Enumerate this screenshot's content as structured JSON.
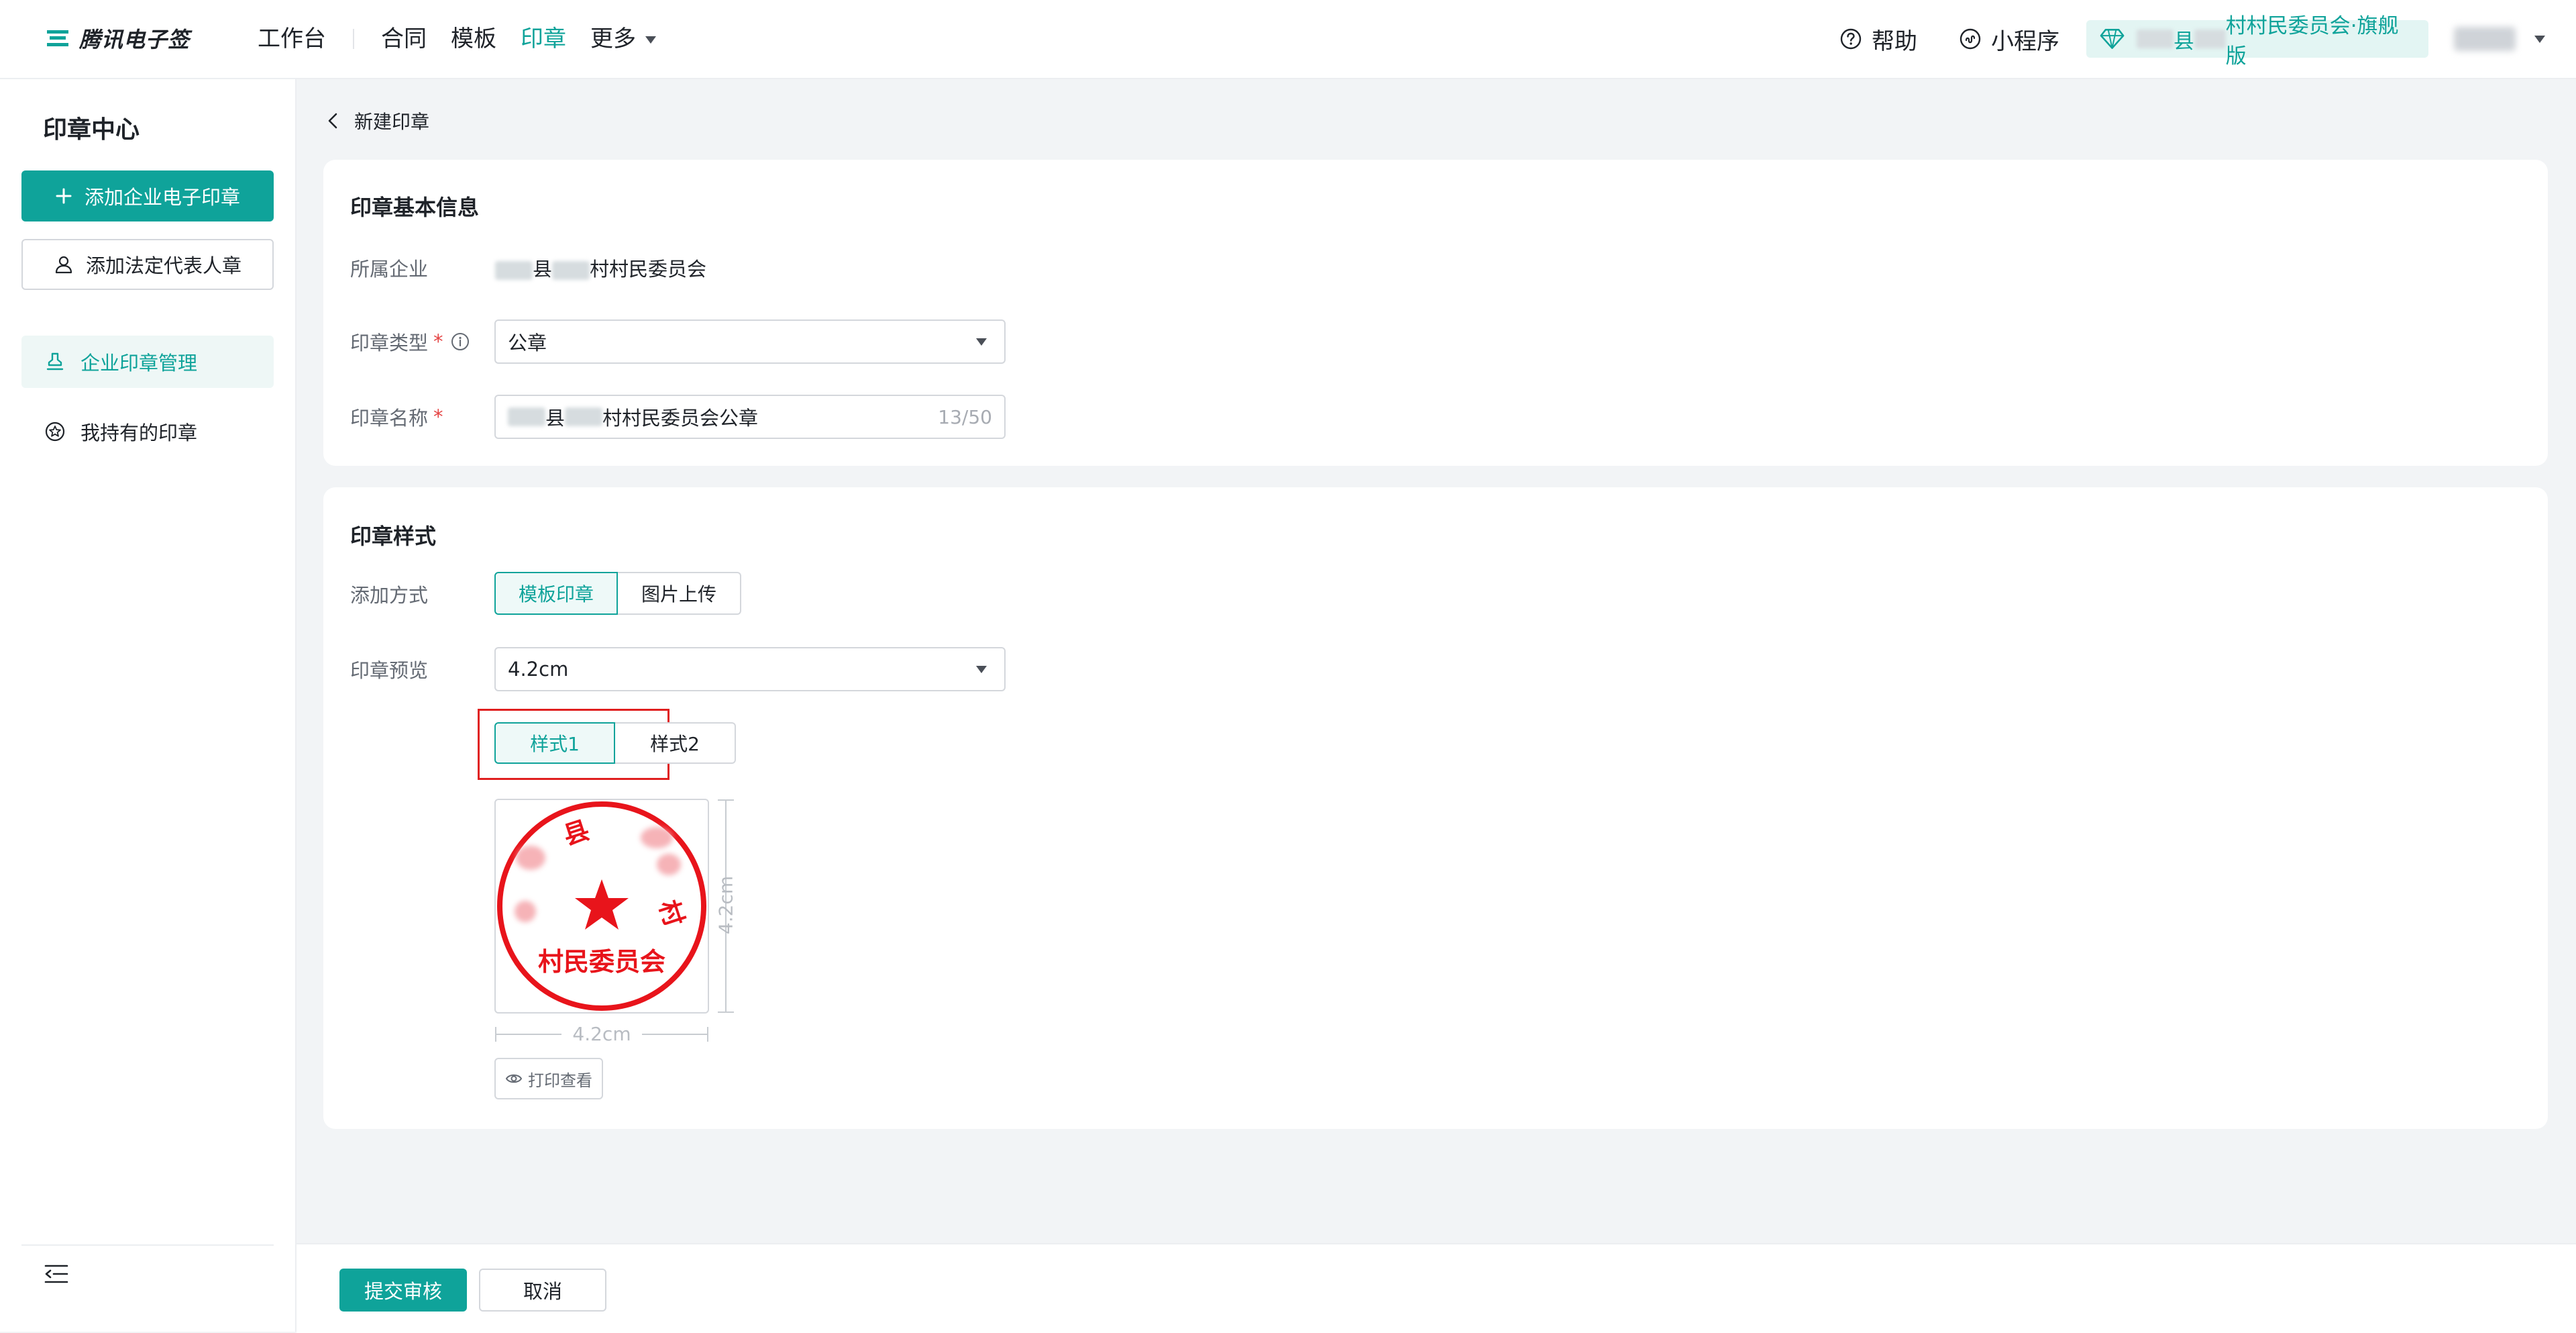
{
  "app": {
    "logo_text": "腾讯电子签",
    "brand_color": "#0fa39a"
  },
  "nav": {
    "items": [
      "工作台",
      "合同",
      "模板",
      "印章",
      "更多"
    ],
    "active": "印章"
  },
  "topright": {
    "help": "帮助",
    "miniprogram": "小程序",
    "tenant_part1": "县",
    "tenant_part2": "村村民委员会·旗舰版"
  },
  "sidebar": {
    "title": "印章中心",
    "add_company_seal": "添加企业电子印章",
    "add_legal_seal": "添加法定代表人章",
    "items": [
      {
        "label": "企业印章管理",
        "icon": "stamp-icon",
        "active": true
      },
      {
        "label": "我持有的印章",
        "icon": "badge-icon",
        "active": false
      }
    ]
  },
  "page": {
    "back_label": "新建印章"
  },
  "basic_info": {
    "title": "印章基本信息",
    "company_label": "所属企业",
    "company_part1": "县",
    "company_part2": "村村民委员会",
    "type_label": "印章类型",
    "type_value": "公章",
    "name_label": "印章名称",
    "name_part1": "县",
    "name_part2": "村村民委员会公章",
    "name_counter": "13/50"
  },
  "style_section": {
    "title": "印章样式",
    "method_label": "添加方式",
    "method_options": [
      "模板印章",
      "图片上传"
    ],
    "method_selected": "模板印章",
    "preview_label": "印章预览",
    "size_value": "4.2cm",
    "style_options": [
      "样式1",
      "样式2"
    ],
    "style_selected": "样式1",
    "seal_top_char1": "县",
    "seal_side_char": "村",
    "seal_bottom_text": "村民委员会",
    "dim_width": "4.2cm",
    "dim_height": "4.2cm",
    "print_view": "打印查看",
    "seal_color": "#e8141b"
  },
  "actions": {
    "submit": "提交审核",
    "cancel": "取消"
  }
}
